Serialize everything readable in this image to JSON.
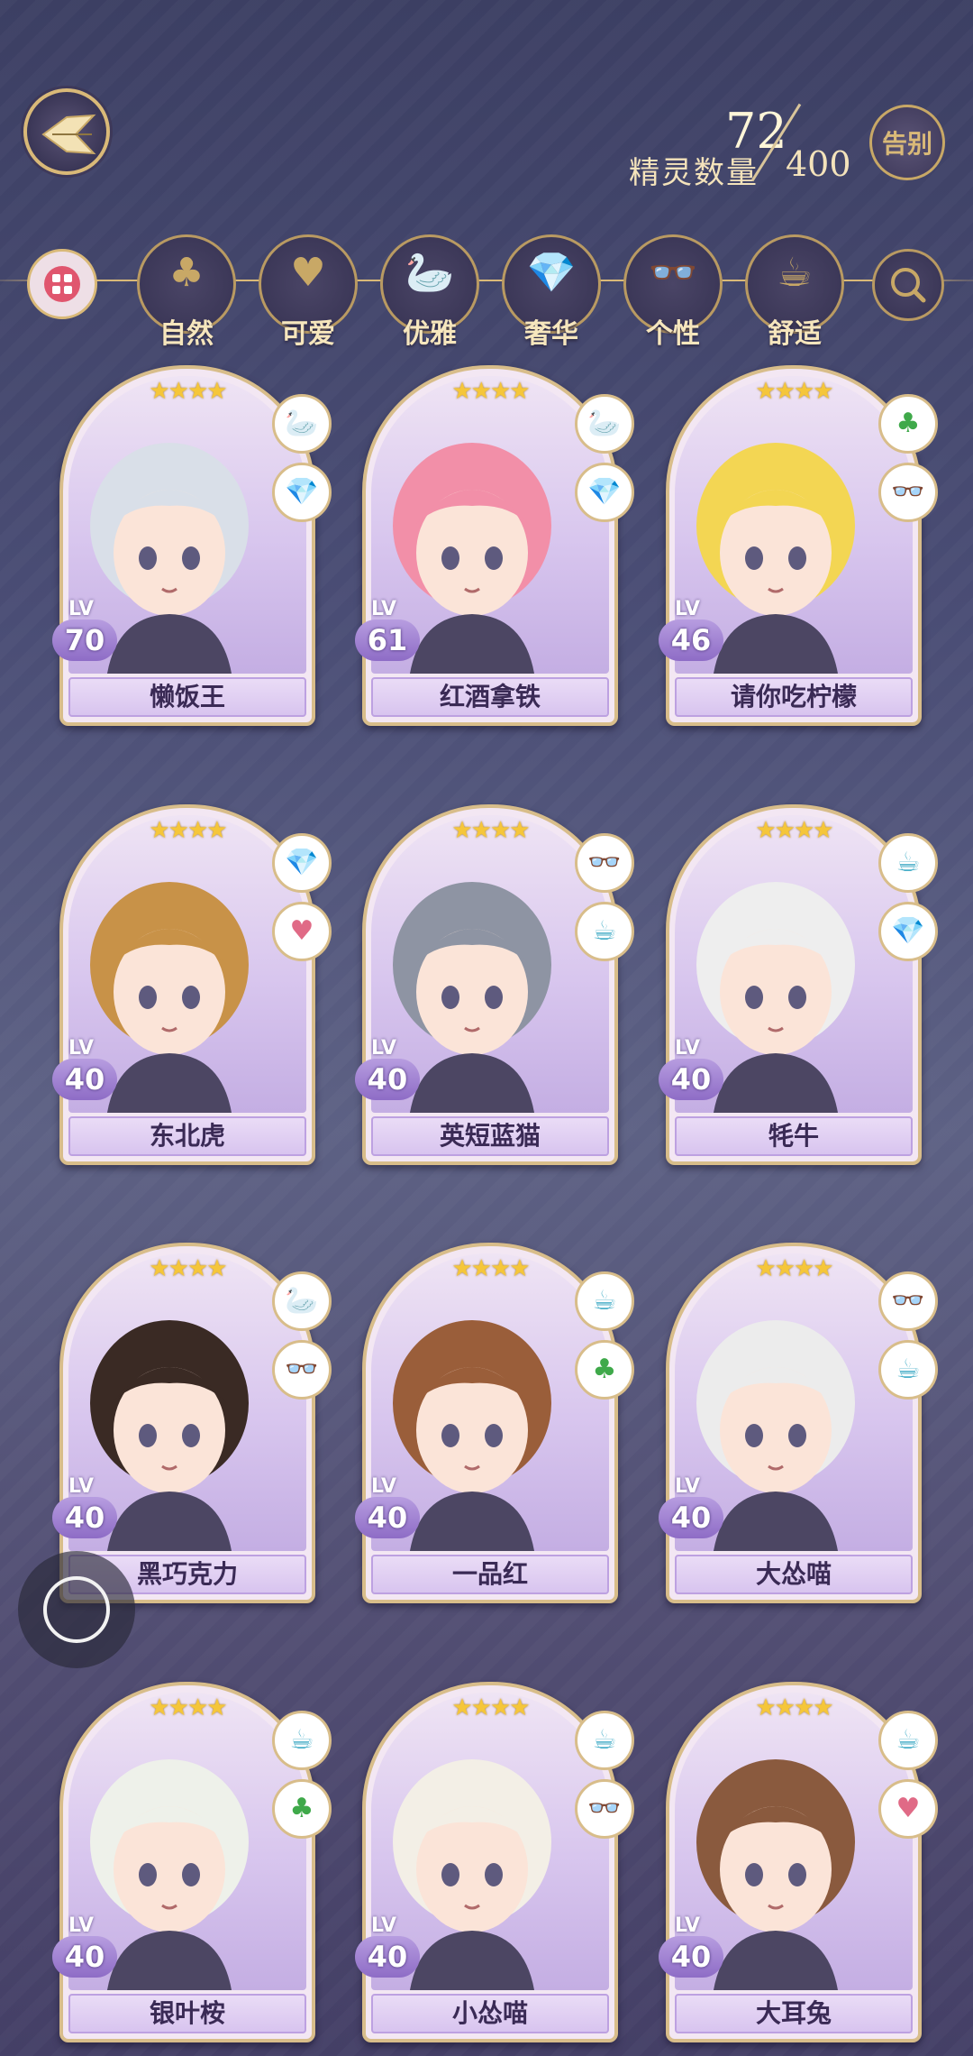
{
  "header": {
    "count_label": "精灵数量",
    "count_current": "72",
    "count_max": "400",
    "farewell_label": "告别"
  },
  "filters": [
    {
      "label": "自然",
      "icon": "clover-icon",
      "glyph": "♣"
    },
    {
      "label": "可爱",
      "icon": "heart-icon",
      "glyph": "♥"
    },
    {
      "label": "优雅",
      "icon": "swan-icon",
      "glyph": "🦢"
    },
    {
      "label": "奢华",
      "icon": "diamond-icon",
      "glyph": "💎"
    },
    {
      "label": "个性",
      "icon": "glasses-icon",
      "glyph": "👓"
    },
    {
      "label": "舒适",
      "icon": "teacup-icon",
      "glyph": "☕"
    }
  ],
  "cards": [
    {
      "name": "懒饭王",
      "lv": "70",
      "stars": "★★★★",
      "badges": [
        "swan-icon",
        "diamond-icon"
      ],
      "hair": "#d9dfe8"
    },
    {
      "name": "红酒拿铁",
      "lv": "61",
      "stars": "★★★★",
      "badges": [
        "swan-icon",
        "diamond-icon"
      ],
      "hair": "#f28fa8"
    },
    {
      "name": "请你吃柠檬",
      "lv": "46",
      "stars": "★★★★",
      "badges": [
        "clover-icon",
        "glasses-icon"
      ],
      "hair": "#f3d653"
    },
    {
      "name": "东北虎",
      "lv": "40",
      "stars": "★★★★",
      "badges": [
        "diamond-icon",
        "heart-icon"
      ],
      "hair": "#c89248"
    },
    {
      "name": "英短蓝猫",
      "lv": "40",
      "stars": "★★★★",
      "badges": [
        "glasses-icon",
        "teacup-icon"
      ],
      "hair": "#8e94a3"
    },
    {
      "name": "牦牛",
      "lv": "40",
      "stars": "★★★★",
      "badges": [
        "teacup-icon",
        "diamond-icon"
      ],
      "hair": "#eeeeee"
    },
    {
      "name": "黑巧克力",
      "lv": "40",
      "stars": "★★★★",
      "badges": [
        "swan-icon",
        "glasses-icon"
      ],
      "hair": "#3a2a24"
    },
    {
      "name": "一品红",
      "lv": "40",
      "stars": "★★★★",
      "badges": [
        "teacup-icon",
        "clover-icon"
      ],
      "hair": "#9a5e3a"
    },
    {
      "name": "大怂喵",
      "lv": "40",
      "stars": "★★★★",
      "badges": [
        "glasses-icon",
        "teacup-icon"
      ],
      "hair": "#ececec"
    },
    {
      "name": "银叶桉",
      "lv": "40",
      "stars": "★★★★",
      "badges": [
        "teacup-icon",
        "clover-icon"
      ],
      "hair": "#eef1ea"
    },
    {
      "name": "小怂喵",
      "lv": "40",
      "stars": "★★★★",
      "badges": [
        "teacup-icon",
        "glasses-icon"
      ],
      "hair": "#f3efe6"
    },
    {
      "name": "大耳兔",
      "lv": "40",
      "stars": "★★★★",
      "badges": [
        "teacup-icon",
        "heart-icon"
      ],
      "hair": "#8a5a3e"
    }
  ],
  "lv_label": "LV",
  "colors": {
    "gold": "#d9b978",
    "card_bg": "#f3e7f3",
    "star": "#f5c63a"
  }
}
